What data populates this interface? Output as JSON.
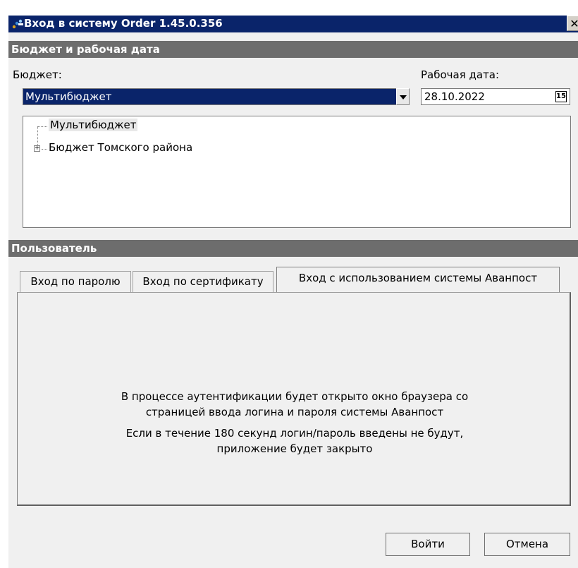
{
  "window": {
    "title": "Вход в систему Order 1.45.0.356",
    "close_glyph": "✕"
  },
  "budget_section": {
    "header": "Бюджет и рабочая дата",
    "budget_label": "Бюджет:",
    "budget_value": "Мультибюджет",
    "date_label": "Рабочая дата:",
    "date_value": "28.10.2022",
    "calendar_icon_text": "15",
    "tree": [
      {
        "label": "Мультибюджет",
        "expandable": false
      },
      {
        "label": "Бюджет Томского района",
        "expandable": true,
        "expander_glyph": "+"
      }
    ]
  },
  "user_section": {
    "header": "Пользователь",
    "tabs": [
      {
        "label": "Вход по паролю",
        "active": false
      },
      {
        "label": "Вход по сертификату",
        "active": false
      },
      {
        "label": "Вход с использованием системы Аванпост",
        "active": true
      }
    ],
    "message_line1": "В процессе аутентификации будет открыто окно браузера со",
    "message_line2": "страницей ввода логина и пароля системы Аванпост",
    "message_line3": "Если в течение 180 секунд логин/пароль введены не будут,",
    "message_line4": "приложение будет закрыто"
  },
  "buttons": {
    "login_label": "Войти",
    "cancel_label": "Отмена"
  },
  "colors": {
    "titlebar": "#0a246a",
    "section_header": "#6d6d6d",
    "selection": "#0a246a",
    "window_bg": "#f0f0f0"
  }
}
